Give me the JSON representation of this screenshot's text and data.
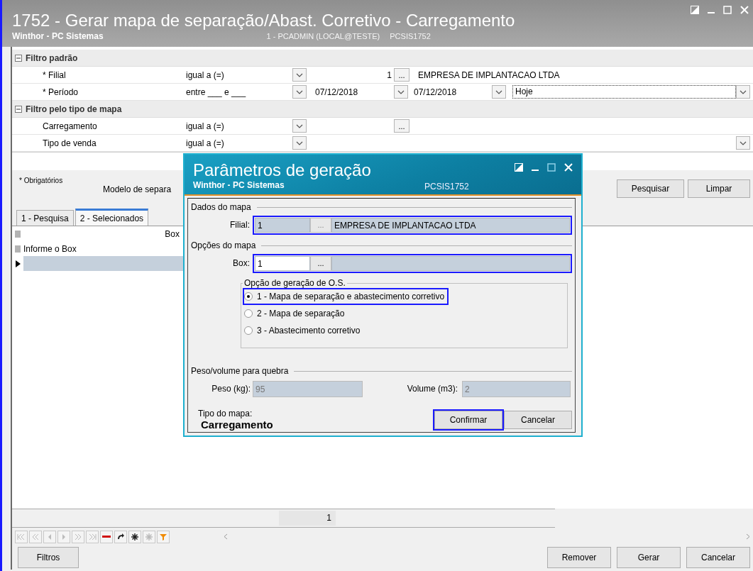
{
  "window": {
    "title": "1752 - Gerar mapa de separação/Abast. Corretivo - Carregamento",
    "subtitle": "Winthor - PC Sistemas",
    "session": "1 - PCADMIN (LOCAL@TESTE)",
    "program_code": "PCSIS1752"
  },
  "filters": [
    {
      "kind": "section",
      "label": "Filtro padrão",
      "expanded": true
    },
    {
      "kind": "field",
      "label": "* Filial",
      "condition": "igual a (=)",
      "value": "1",
      "lookup": "...",
      "description": "EMPRESA DE IMPLANTACAO LTDA"
    },
    {
      "kind": "range",
      "label": "* Período",
      "condition": "entre ___ e ___",
      "from": "07/12/2018",
      "to": "07/12/2018",
      "preset": "Hoje"
    },
    {
      "kind": "section",
      "label": "Filtro pelo tipo de mapa",
      "expanded": true
    },
    {
      "kind": "field",
      "label": "Carregamento",
      "condition": "igual a (=)",
      "lookup": "..."
    },
    {
      "kind": "select",
      "label": "Tipo de venda",
      "condition": "igual a (=)"
    }
  ],
  "required_note": "* Obrigatórios",
  "model_label": "Modelo de separa",
  "actions": [
    "Pesquisar",
    "Limpar"
  ],
  "tabs": [
    {
      "label": "1 - Pesquisa",
      "selected": false
    },
    {
      "label": "2 - Selecionados",
      "selected": true
    }
  ],
  "grid": {
    "column": "Box",
    "filter_hint": "Informe o Box",
    "rows": [
      {
        "selected": true
      }
    ],
    "footer": "1"
  },
  "nav_buttons": [
    {
      "kind": "first",
      "disabled": true
    },
    {
      "kind": "prev-page",
      "disabled": true
    },
    {
      "kind": "prev",
      "disabled": true
    },
    {
      "kind": "next",
      "disabled": true
    },
    {
      "kind": "next-page",
      "disabled": true
    },
    {
      "kind": "last",
      "disabled": true
    },
    {
      "kind": "delete",
      "disabled": false
    },
    {
      "kind": "refresh",
      "disabled": false
    },
    {
      "kind": "star",
      "disabled": false
    },
    {
      "kind": "star",
      "disabled": true
    },
    {
      "kind": "filter",
      "disabled": false
    }
  ],
  "bottom_buttons": {
    "left": [
      "Filtros"
    ],
    "right": [
      "Remover",
      "Gerar",
      "Cancelar"
    ]
  },
  "dialog": {
    "title": "Parâmetros de geração",
    "subtitle": "Winthor - PC Sistemas",
    "program_code": "PCSIS1752",
    "map_data": {
      "heading": "Dados do mapa",
      "label": "Filial:",
      "code": "1",
      "lookup": "...",
      "name": "EMPRESA DE IMPLANTACAO LTDA",
      "highlighted": true
    },
    "map_options": {
      "heading": "Opções do mapa",
      "label": "Box:",
      "code": "1",
      "lookup": "...",
      "highlighted": true,
      "group": "Opção de geração de O.S.",
      "options": [
        {
          "label": "1 - Mapa de separação e abastecimento corretivo",
          "selected": true,
          "highlighted": true
        },
        {
          "label": "2 - Mapa de separação",
          "selected": false,
          "highlighted": false
        },
        {
          "label": "3 - Abastecimento corretivo",
          "selected": false,
          "highlighted": false
        }
      ]
    },
    "break": {
      "heading": "Peso/volume para quebra",
      "weight_label": "Peso (kg):",
      "weight": "95",
      "volume_label": "Volume (m3):",
      "volume": "2"
    },
    "map_type": {
      "label": "Tipo do mapa:",
      "value": "Carregamento"
    },
    "buttons": [
      {
        "label": "Confirmar",
        "highlighted": true
      },
      {
        "label": "Cancelar",
        "highlighted": false
      }
    ]
  }
}
